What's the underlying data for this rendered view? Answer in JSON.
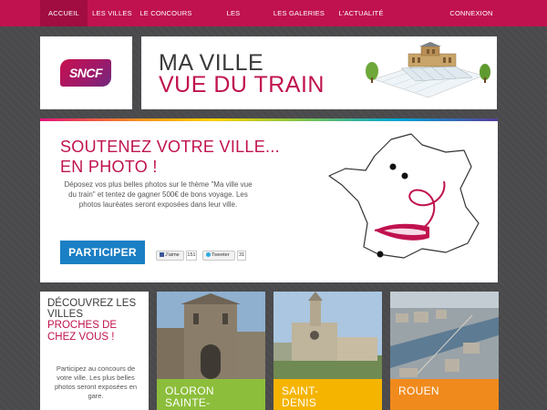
{
  "nav": {
    "items": [
      {
        "label": "ACCUEIL",
        "active": true
      },
      {
        "label": "LES VILLES",
        "active": false
      },
      {
        "label": "LE CONCOURS",
        "active": false
      },
      {
        "label": "LES EXPOSITIONS",
        "active": false
      },
      {
        "label": "LES GALERIES",
        "active": false
      },
      {
        "label": "L'ACTUALITÉ",
        "active": false
      }
    ],
    "connexion": "CONNEXION"
  },
  "header": {
    "logo": "SNCF",
    "title_line1": "MA VILLE",
    "title_line2": "VUE DU TRAIN"
  },
  "hero": {
    "title_line1": "SOUTENEZ VOTRE VILLE...",
    "title_line2": "EN PHOTO !",
    "description": "Déposez vos plus belles photos sur le thème \"Ma ville vue du train\" et tentez de gagner 500€ de bons voyage. Les photos lauréates seront exposées dans leur ville.",
    "cta": "PARTICIPER",
    "like_label": "J'aime",
    "like_count": "151",
    "tweet_label": "Tweeter",
    "tweet_count": "31"
  },
  "villes": {
    "title_line1": "DÉCOUVREZ LES VILLES",
    "title_line2": "PROCHES DE CHEZ VOUS !",
    "text": "Participez au concours de votre ville. Les plus belles photos seront exposées en gare."
  },
  "cities": [
    {
      "label_line1": "OLORON",
      "label_line2": "SAINTE-",
      "color": "#8cbe3b"
    },
    {
      "label_line1": "SAINT-",
      "label_line2": "DENIS",
      "color": "#f5b400"
    },
    {
      "label_line1": "ROUEN",
      "label_line2": "",
      "color": "#f08a1c"
    }
  ],
  "colors": {
    "brand": "#c0124f",
    "nav_bg": "#c0124f",
    "cta_blue": "#1a7fc4"
  }
}
